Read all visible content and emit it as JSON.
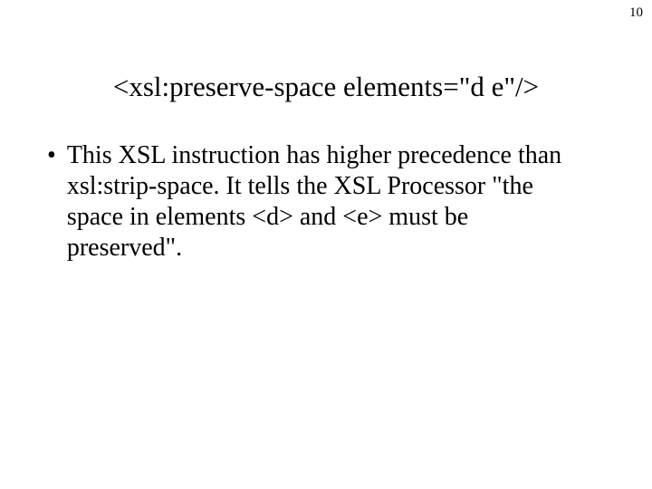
{
  "page_number": "10",
  "title": "<xsl:preserve-space elements=\"d e\"/>",
  "bullets": [
    {
      "text": "This XSL instruction has higher precedence than xsl:strip-space.  It tells the XSL Processor \"the space in elements <d> and <e> must be preserved\"."
    }
  ]
}
